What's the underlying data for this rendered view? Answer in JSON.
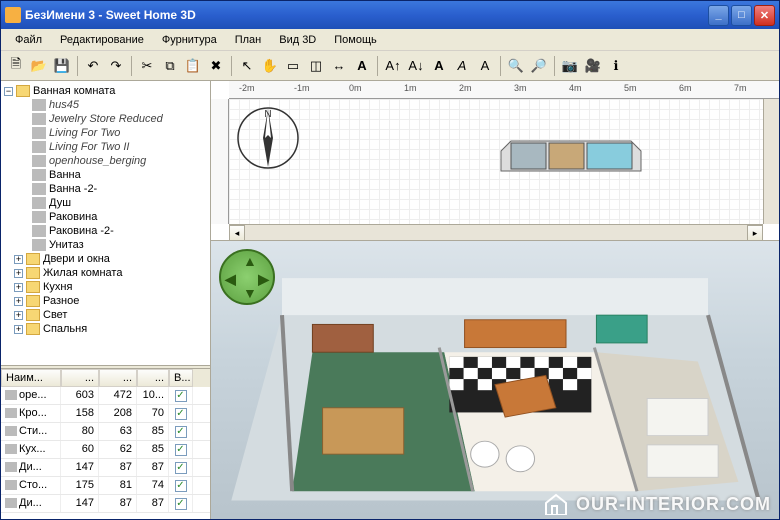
{
  "window": {
    "title": "БезИмени 3 - Sweet Home 3D"
  },
  "menu": {
    "file": "Файл",
    "edit": "Редактирование",
    "furniture": "Фурнитура",
    "plan": "План",
    "view3d": "Вид 3D",
    "help": "Помощь"
  },
  "toolbar_icons": [
    "new",
    "open",
    "save",
    "undo",
    "redo",
    "cut",
    "copy",
    "paste",
    "delete",
    "sep",
    "cursor",
    "pan",
    "wall",
    "room",
    "dimension",
    "text",
    "sep",
    "bold",
    "italic",
    "align-l",
    "align-c",
    "align-r",
    "sep",
    "zoom-in",
    "zoom-out",
    "sep",
    "camera",
    "photo",
    "help"
  ],
  "ruler": {
    "ticks": [
      "-2m",
      "-1m",
      "0m",
      "1m",
      "2m",
      "3m",
      "4m",
      "5m",
      "6m",
      "7m"
    ]
  },
  "catalog": {
    "root": "Ванная комната",
    "items": [
      "hus45",
      "Jewelry Store Reduced",
      "Living For Two",
      "Living For Two II",
      "openhouse_berging"
    ],
    "items_nrm": [
      "Ванна",
      "Ванна -2-",
      "Душ",
      "Раковина",
      "Раковина -2-",
      "Унитаз"
    ],
    "folders": [
      "Двери и окна",
      "Жилая комната",
      "Кухня",
      "Разное",
      "Свет",
      "Спальня"
    ]
  },
  "furniture_table": {
    "headers": [
      "Наим...",
      "...",
      "...",
      "...",
      "В..."
    ],
    "rows": [
      {
        "name": "оре...",
        "w": "603",
        "d": "472",
        "h": "10...",
        "vis": true
      },
      {
        "name": "Кро...",
        "w": "158",
        "d": "208",
        "h": "70",
        "vis": true
      },
      {
        "name": "Сти...",
        "w": "80",
        "d": "63",
        "h": "85",
        "vis": true
      },
      {
        "name": "Кух...",
        "w": "60",
        "d": "62",
        "h": "85",
        "vis": true
      },
      {
        "name": "Ди...",
        "w": "147",
        "d": "87",
        "h": "87",
        "vis": true
      },
      {
        "name": "Сто...",
        "w": "175",
        "d": "81",
        "h": "74",
        "vis": true
      },
      {
        "name": "Ди...",
        "w": "147",
        "d": "87",
        "h": "87",
        "vis": true
      }
    ]
  },
  "compass": {
    "label": "N"
  },
  "watermark": {
    "text": "OUR-INTERIOR.COM"
  }
}
